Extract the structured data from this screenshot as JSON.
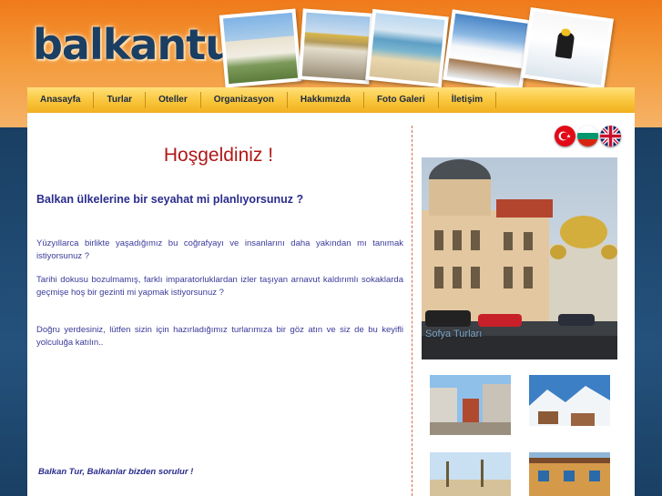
{
  "header": {
    "logo_text": "balkantur",
    "photos": [
      "palace-photo",
      "cathedral-photo",
      "beach-photo",
      "ski-resort-photo",
      "skier-photo"
    ]
  },
  "nav": {
    "items": [
      "Anasayfa",
      "Turlar",
      "Oteller",
      "Organizasyon",
      "Hakkımızda",
      "Foto Galeri",
      "İletişim"
    ]
  },
  "main": {
    "welcome": "Hoşgeldiniz !",
    "question": "Balkan ülkelerine bir seyahat mi planlıyorsunuz ?",
    "paragraphs": [
      "Yüzyıllarca birlikte yaşadığımız bu coğrafyayı ve insanlarını daha yakından mı tanımak istiyorsunuz ?",
      "Tarihi dokusu bozulmamış, farklı imparatorluklardan izler taşıyan arnavut kaldırımlı sokaklarda geçmişe hoş bir gezinti mi yapmak istiyorsunuz ?",
      "Doğru yerdesiniz, lütfen sizin için hazırladığımız turlarımıza bir göz atın ve siz de bu keyifli yolculuğa katılın.."
    ],
    "slogan": "Balkan Tur, Balkanlar bizden sorulur !"
  },
  "sidebar": {
    "flags": [
      "turkey-flag",
      "bulgaria-flag",
      "uk-flag"
    ],
    "feature_caption": "Sofya Turları",
    "thumbnails": [
      "town-street-thumb",
      "snowy-village-thumb",
      "coastal-town-thumb",
      "old-houses-thumb"
    ]
  },
  "colors": {
    "header_orange": "#f07a1a",
    "nav_yellow": "#f9c53a",
    "navy": "#1a3f63",
    "welcome_red": "#b01818",
    "text_blue": "#2a2c8c"
  }
}
